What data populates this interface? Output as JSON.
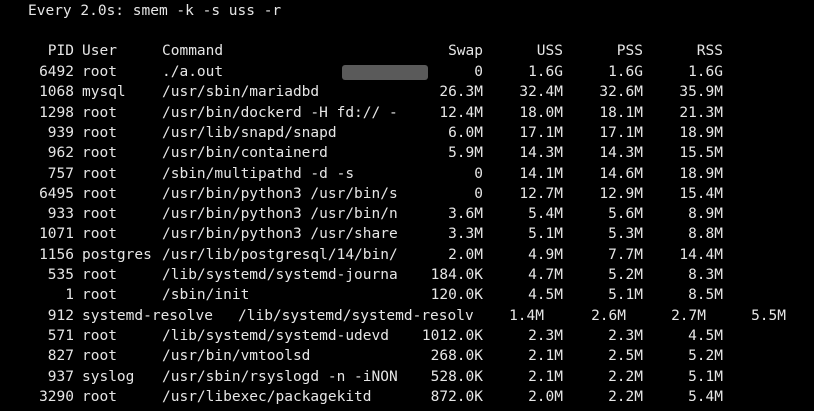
{
  "window": {
    "watch_header": "Every 2.0s: smem -k -s uss -r"
  },
  "table": {
    "columns": [
      "PID",
      "User",
      "Command",
      "Swap",
      "USS",
      "PSS",
      "RSS"
    ],
    "rows": [
      {
        "pid": "6492",
        "user": "root",
        "command": "./a.out",
        "swap": "0",
        "uss": "1.6G",
        "pss": "1.6G",
        "rss": "1.6G",
        "redacted": true
      },
      {
        "pid": "1068",
        "user": "mysql",
        "command": "/usr/sbin/mariadbd",
        "swap": "26.3M",
        "uss": "32.4M",
        "pss": "32.6M",
        "rss": "35.9M"
      },
      {
        "pid": "1298",
        "user": "root",
        "command": "/usr/bin/dockerd -H fd:// -",
        "swap": "12.4M",
        "uss": "18.0M",
        "pss": "18.1M",
        "rss": "21.3M"
      },
      {
        "pid": "939",
        "user": "root",
        "command": "/usr/lib/snapd/snapd",
        "swap": "6.0M",
        "uss": "17.1M",
        "pss": "17.1M",
        "rss": "18.9M"
      },
      {
        "pid": "962",
        "user": "root",
        "command": "/usr/bin/containerd",
        "swap": "5.9M",
        "uss": "14.3M",
        "pss": "14.3M",
        "rss": "15.5M"
      },
      {
        "pid": "757",
        "user": "root",
        "command": "/sbin/multipathd -d -s",
        "swap": "0",
        "uss": "14.1M",
        "pss": "14.6M",
        "rss": "18.9M"
      },
      {
        "pid": "6495",
        "user": "root",
        "command": "/usr/bin/python3 /usr/bin/s",
        "swap": "0",
        "uss": "12.7M",
        "pss": "12.9M",
        "rss": "15.4M"
      },
      {
        "pid": "933",
        "user": "root",
        "command": "/usr/bin/python3 /usr/bin/n",
        "swap": "3.6M",
        "uss": "5.4M",
        "pss": "5.6M",
        "rss": "8.9M"
      },
      {
        "pid": "1071",
        "user": "root",
        "command": "/usr/bin/python3 /usr/share",
        "swap": "3.3M",
        "uss": "5.1M",
        "pss": "5.3M",
        "rss": "8.8M"
      },
      {
        "pid": "1156",
        "user": "postgres",
        "command": "/usr/lib/postgresql/14/bin/",
        "swap": "2.0M",
        "uss": "4.9M",
        "pss": "7.7M",
        "rss": "14.4M"
      },
      {
        "pid": "535",
        "user": "root",
        "command": "/lib/systemd/systemd-journa",
        "swap": "184.0K",
        "uss": "4.7M",
        "pss": "5.2M",
        "rss": "8.3M"
      },
      {
        "pid": "1",
        "user": "root",
        "command": "/sbin/init",
        "swap": "120.0K",
        "uss": "4.5M",
        "pss": "5.1M",
        "rss": "8.5M"
      },
      {
        "pid": "912",
        "user": "systemd-resolve",
        "command": "/lib/systemd/systemd-resolv",
        "swap": "1.4M",
        "uss": "2.6M",
        "pss": "2.7M",
        "rss": "5.5M",
        "shifted": true
      },
      {
        "pid": "571",
        "user": "root",
        "command": "/lib/systemd/systemd-udevd",
        "swap": "1012.0K",
        "uss": "2.3M",
        "pss": "2.3M",
        "rss": "4.5M"
      },
      {
        "pid": "827",
        "user": "root",
        "command": "/usr/bin/vmtoolsd",
        "swap": "268.0K",
        "uss": "2.1M",
        "pss": "2.5M",
        "rss": "5.2M"
      },
      {
        "pid": "937",
        "user": "syslog",
        "command": "/usr/sbin/rsyslogd -n -iNON",
        "swap": "528.0K",
        "uss": "2.1M",
        "pss": "2.2M",
        "rss": "5.1M"
      },
      {
        "pid": "3290",
        "user": "root",
        "command": "/usr/libexec/packagekitd",
        "swap": "872.0K",
        "uss": "2.0M",
        "pss": "2.2M",
        "rss": "5.4M"
      }
    ]
  },
  "colors": {
    "background": "#000000",
    "foreground": "#e6e6e6",
    "redaction": "#5a5a5a"
  }
}
